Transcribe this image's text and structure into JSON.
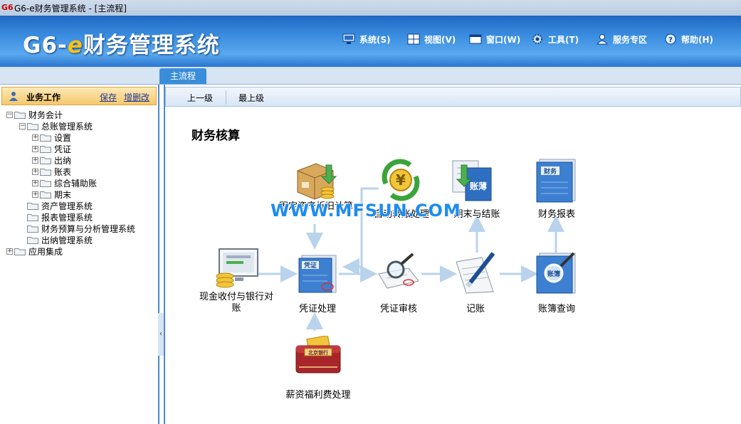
{
  "window": {
    "app_icon_text": "G6",
    "title": "G6-e财务管理系统 - [主流程]"
  },
  "header": {
    "logo_prefix": "G6-",
    "logo_e": "e",
    "logo_suffix": "财务管理系统",
    "menu": [
      {
        "label": "系统(S)",
        "icon": "monitor-icon"
      },
      {
        "label": "视图(V)",
        "icon": "grid-view-icon"
      },
      {
        "label": "窗口(W)",
        "icon": "window-icon"
      },
      {
        "label": "工具(T)",
        "icon": "gear-icon"
      },
      {
        "label": "服务专区",
        "icon": "service-person-icon"
      },
      {
        "label": "帮助(H)",
        "icon": "help-icon"
      }
    ]
  },
  "tabs": [
    {
      "label": "主流程",
      "active": true
    }
  ],
  "left_panel": {
    "title": "业务工作",
    "save_link": "保存",
    "edit_link": "增删改",
    "tree": [
      {
        "label": "财务会计",
        "level": 0,
        "toggle": "−"
      },
      {
        "label": "总账管理系统",
        "level": 1,
        "toggle": "−"
      },
      {
        "label": "设置",
        "level": 2,
        "toggle": "+"
      },
      {
        "label": "凭证",
        "level": 2,
        "toggle": "+"
      },
      {
        "label": "出纳",
        "level": 2,
        "toggle": "+"
      },
      {
        "label": "账表",
        "level": 2,
        "toggle": "+"
      },
      {
        "label": "综合辅助账",
        "level": 2,
        "toggle": "+"
      },
      {
        "label": "期末",
        "level": 2,
        "toggle": "+"
      },
      {
        "label": "资产管理系统",
        "level": 1,
        "toggle": ""
      },
      {
        "label": "报表管理系统",
        "level": 1,
        "toggle": ""
      },
      {
        "label": "财务预算与分析管理系统",
        "level": 1,
        "toggle": ""
      },
      {
        "label": "出纳管理系统",
        "level": 1,
        "toggle": ""
      },
      {
        "label": "应用集成",
        "level": 0,
        "toggle": "+"
      }
    ],
    "splitter_glyph": "‹"
  },
  "toolbar": {
    "up_label": "上一级",
    "top_label": "最上级"
  },
  "flow": {
    "title": "财务核算",
    "nodes": {
      "asset": "固定资产折旧计算",
      "transfer": "自动转账处理",
      "closing": "期末与结账",
      "report": "财务报表",
      "cash": "现金收付与银行对账",
      "voucher": "凭证处理",
      "audit": "凭证审核",
      "posting": "记账",
      "ledger": "账簿查询",
      "payroll": "薪资福利费处理"
    },
    "icon_texts": {
      "voucher": "凭证",
      "closing": "账薄",
      "report": "财务",
      "ledger": "账簿",
      "payroll": "北京银行"
    }
  },
  "watermark": "WWW.MFSUN.COM",
  "colors": {
    "header_blue": "#2f7fd6",
    "accent_gold": "#f4c21a",
    "tab_active": "#3a8ed9",
    "link_blue": "#1a3a9e"
  }
}
